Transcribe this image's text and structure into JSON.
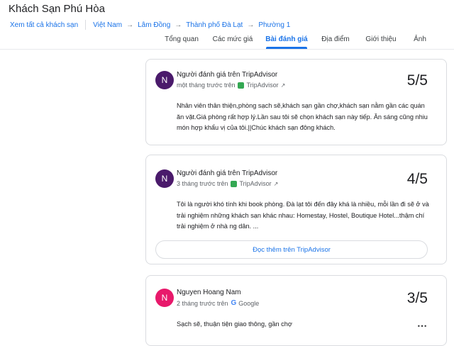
{
  "hotel": {
    "name": "Khách Sạn Phú Hòa"
  },
  "breadcrumb": {
    "see_all": "Xem tất cả khách sạn",
    "path": [
      "Việt Nam",
      "Lâm Đồng",
      "Thành phố Đà Lạt",
      "Phường 1"
    ],
    "arrow": "→"
  },
  "tabs": [
    {
      "label": "Tổng quan",
      "active": false
    },
    {
      "label": "Các mức giá",
      "active": false
    },
    {
      "label": "Bài đánh giá",
      "active": true
    },
    {
      "label": "Địa điểm",
      "active": false
    },
    {
      "label": "Giới thiệu",
      "active": false
    },
    {
      "label": "Ảnh",
      "active": false
    }
  ],
  "colors": {
    "accent": "#1a73e8",
    "avatar1": "#4a1a6b",
    "avatar2": "#4a1a6b",
    "avatar3": "#e8196b"
  },
  "reviews": [
    {
      "avatar": "N",
      "author": "Người đánh giá trên TripAdvisor",
      "time": "một tháng trước trên",
      "source": "TripAdvisor",
      "source_icon": "tripadvisor-icon",
      "score": "5/5",
      "text": "Nhân viên thân thiện,phòng sạch sẽ,khách sạn gần chợ,khách sạn nằm gần các quán ăn vặt.Giá phòng rất hợp lý.Lần sau tôi sẽ chọn khách sạn này tiếp. Ăn sáng cũng nhiu món hợp khẩu vị của tôi.||Chúc khách sạn đông khách."
    },
    {
      "avatar": "N",
      "author": "Người đánh giá trên TripAdvisor",
      "time": "3 tháng trước trên",
      "source": "TripAdvisor",
      "source_icon": "tripadvisor-icon",
      "score": "4/5",
      "text": "Tôi là người khó tính khi book phòng. Đà lạt tôi đến đây khá là nhiều, mỗi lần đi sẽ ở và trải nghiệm những khách sạn khác nhau: Homestay, Hostel, Boutique Hotel...thậm chí trải nghiệm ở nhà ng dân. ...",
      "read_more": "Đọc thêm trên TripAdvisor"
    },
    {
      "avatar": "N",
      "author": "Nguyen Hoang Nam",
      "time": "2 tháng trước trên",
      "source": "Google",
      "source_icon": "google-icon",
      "score": "3/5",
      "text": "Sạch sẽ, thuận tiện giao thông, gần chợ"
    }
  ]
}
